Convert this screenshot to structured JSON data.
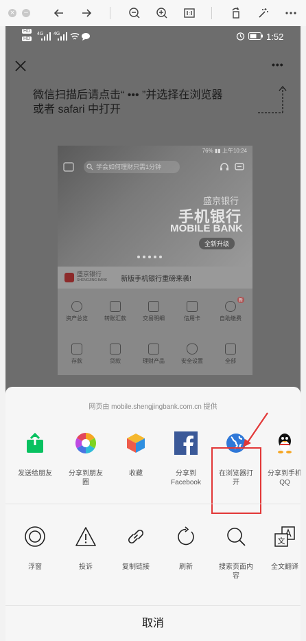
{
  "viewer": {
    "buttons": [
      "close",
      "minimize",
      "back",
      "forward",
      "zoom-out",
      "zoom-in",
      "actual-size",
      "rotate",
      "magic",
      "more"
    ]
  },
  "status": {
    "network_left_1": "HD",
    "network_left_2": "HD",
    "network_4g_1": "4G",
    "network_4g_2": "4G",
    "time": "1:52"
  },
  "topbar": {
    "more_label": "•••"
  },
  "hint": {
    "line1": "微信扫描后请点击“ ••• ”并选择在浏览器",
    "line2": "或者 safari 中打开"
  },
  "shot": {
    "status_right": "76% ▮▮ 上午10:24",
    "search_placeholder": "学会如何理财只需1分钟",
    "bank_cn": "盛京银行",
    "title_big": "手机银行",
    "title_en": "MOBILE BANK",
    "pill": "全新升级",
    "logo_text": "盛京银行",
    "logo_sub": "SHENGJING BANK",
    "news": "新版手机银行重磅来袭!",
    "badge": "新",
    "grid": [
      "资产总览",
      "转账汇款",
      "交易明细",
      "信用卡",
      "自助缴费",
      "存款",
      "贷款",
      "理财产品",
      "安全设置",
      "全部"
    ]
  },
  "sheet": {
    "source": "网页由 mobile.shengjingbank.com.cn 提供",
    "share_items": [
      {
        "label_1": "发送给朋友",
        "label_2": ""
      },
      {
        "label_1": "分享到朋友",
        "label_2": "圈"
      },
      {
        "label_1": "收藏",
        "label_2": ""
      },
      {
        "label_1": "分享到",
        "label_2": "Facebook"
      },
      {
        "label_1": "在浏览器打",
        "label_2": "开"
      },
      {
        "label_1": "分享到手机",
        "label_2": "QQ"
      }
    ],
    "actions": [
      {
        "label_1": "浮窗",
        "label_2": ""
      },
      {
        "label_1": "投诉",
        "label_2": ""
      },
      {
        "label_1": "复制链接",
        "label_2": ""
      },
      {
        "label_1": "刷新",
        "label_2": ""
      },
      {
        "label_1": "搜索页面内",
        "label_2": "容"
      },
      {
        "label_1": "全文翻译",
        "label_2": ""
      }
    ],
    "cancel": "取消"
  },
  "colors": {
    "wechat_green": "#07c160",
    "highlight_red": "#e23737",
    "facebook_blue": "#3b5998",
    "browser_blue": "#2f78d8"
  }
}
